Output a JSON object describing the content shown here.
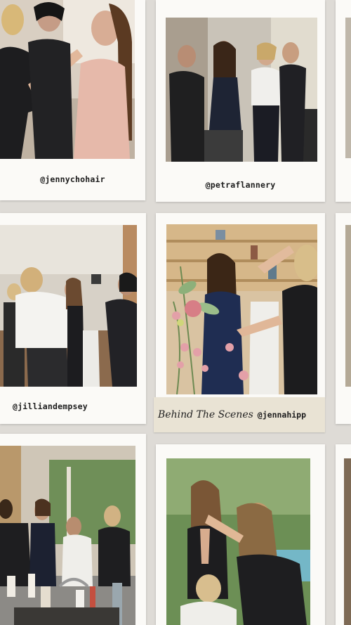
{
  "collage": {
    "captions": {
      "card1": "@jennychohair",
      "card2": "@petraflannery",
      "card3": "@jilliandempsey"
    },
    "tape": {
      "script": "Behind The Scenes",
      "handle": "@jennahipp"
    }
  }
}
